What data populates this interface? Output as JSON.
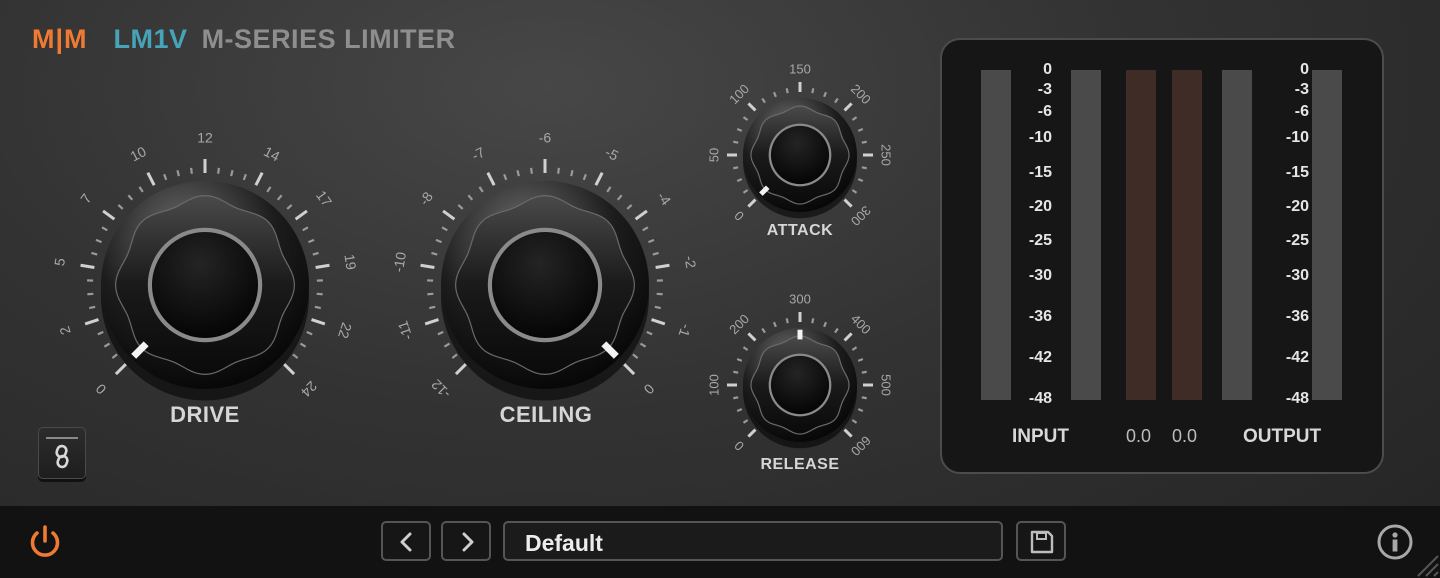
{
  "header": {
    "logo": "M|M",
    "model": "LM1V",
    "product": "M-SERIES LIMITER"
  },
  "knobs": {
    "drive": {
      "label": "DRIVE",
      "ticks": [
        "0",
        "2",
        "5",
        "7",
        "10",
        "12",
        "14",
        "17",
        "19",
        "22",
        "24"
      ],
      "value_fraction": 0.0
    },
    "ceiling": {
      "label": "CEILING",
      "ticks": [
        "-12",
        "-11",
        "-10",
        "-8",
        "-7",
        "-6",
        "-5",
        "-4",
        "-2",
        "-1",
        "0"
      ],
      "value_fraction": 1.0
    },
    "attack": {
      "label": "ATTACK",
      "ticks": [
        "0",
        "50",
        "100",
        "150",
        "200",
        "250",
        "300"
      ],
      "value_fraction": 0.0
    },
    "release": {
      "label": "RELEASE",
      "ticks": [
        "0",
        "100",
        "200",
        "300",
        "400",
        "500",
        "600"
      ],
      "value_fraction": 0.5
    }
  },
  "meter": {
    "scale": [
      "0",
      "-3",
      "-6",
      "-10",
      "-15",
      "-20",
      "-25",
      "-30",
      "-36",
      "-42",
      "-48"
    ],
    "input_label": "INPUT",
    "output_label": "OUTPUT",
    "gr_left": "0.0",
    "gr_right": "0.0"
  },
  "footer": {
    "preset": "Default"
  },
  "colors": {
    "accent": "#f07a32",
    "model": "#46a4b8",
    "gr_bar": "#3f2c26",
    "meter_bar": "#4a4a4a"
  }
}
